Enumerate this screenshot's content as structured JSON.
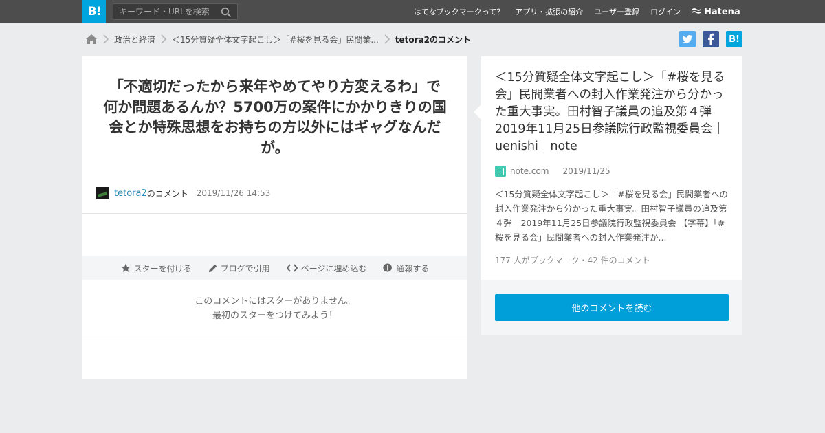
{
  "header": {
    "logo": "B!",
    "search_placeholder": "キーワード・URLを検索",
    "nav": [
      "はてなブックマークって？",
      "アプリ・拡張の紹介",
      "ユーザー登録",
      "ログイン"
    ],
    "brand": "Hatena"
  },
  "breadcrumb": {
    "items": [
      "政治と経済",
      "＜15分質疑全体文字起こし＞「#桜を見る会」民間業...",
      "tetora2のコメント"
    ]
  },
  "share": {
    "hatena_label": "B!"
  },
  "comment": {
    "text": "「不適切だったから来年やめてやり方変えるわ」で何か問題あるんか？5700万の案件にかかりきりの国会とか特殊思想をお持ちの方以外にはギャグなんだが。",
    "user": "tetora2",
    "suffix": "のコメント",
    "timestamp": "2019/11/26 14:53"
  },
  "actions": {
    "star": "スターを付ける",
    "blog": "ブログで引用",
    "embed": "ページに埋め込む",
    "report": "通報する"
  },
  "stars": {
    "line1": "このコメントにはスターがありません。",
    "line2": "最初のスターをつけてみよう！"
  },
  "entry": {
    "title": "＜15分質疑全体文字起こし＞「#桜を見る会」民間業者への封入作業発注から分かった重大事実。田村智子議員の追及第４弾　2019年11月25日参議院行政監視委員会｜uenishi｜note",
    "domain": "note.com",
    "date": "2019/11/25",
    "summary": "＜15分質疑全体文字起こし＞「#桜を見る会」民間業者への封入作業発注から分かった重大事実。田村智子議員の追及第４弾　2019年11月25日参議院行政監視委員会 【字幕】「#桜を見る会」民間業者への封入作業発注か...",
    "count": "177 人がブックマーク・42 件のコメント"
  },
  "more_button": "他のコメントを読む",
  "colors": {
    "topbar": "#4d4d4d",
    "brand_blue": "#00a4de",
    "button_blue": "#009fda",
    "twitter": "#55acee",
    "facebook": "#3b5998",
    "link": "#2a8cb6"
  }
}
